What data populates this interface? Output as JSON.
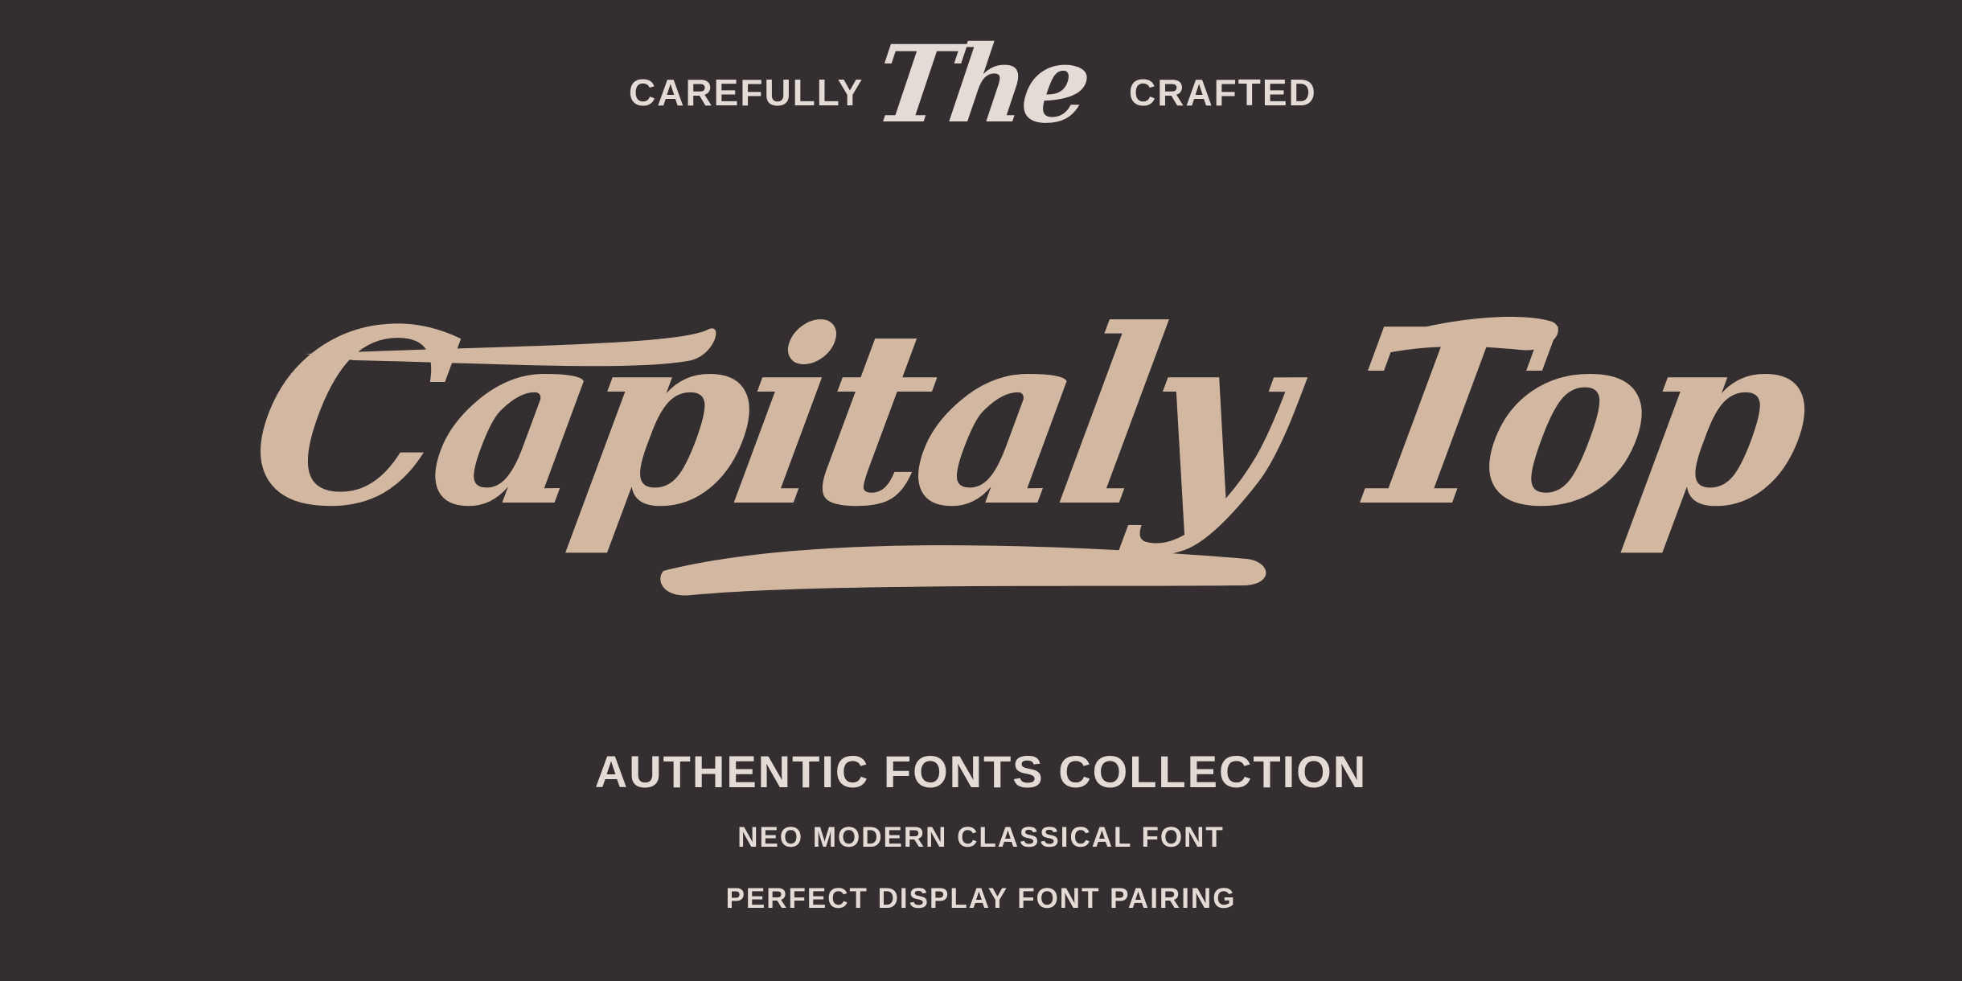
{
  "header": {
    "left_word": "CAREFULLY",
    "script_word": "The",
    "right_word": "CRAFTED"
  },
  "title": {
    "text": "Capitaly Top"
  },
  "taglines": {
    "primary": "AUTHENTIC FONTS COLLECTION",
    "secondary": "NEO MODERN CLASSICAL FONT",
    "tertiary": "PERFECT DISPLAY FONT PAIRING"
  },
  "colors": {
    "background": "#332e30",
    "title": "#d3b8a1",
    "text": "#e3dcd6"
  }
}
